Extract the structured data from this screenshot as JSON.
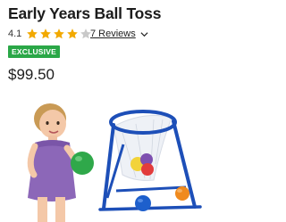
{
  "product": {
    "title": "Early Years Ball Toss",
    "rating": "4.1",
    "stars_filled": 4,
    "stars_total": 5,
    "reviews_label": "7 Reviews",
    "badge": "EXCLUSIVE",
    "price": "$99.50"
  },
  "icons": {
    "star": "star-icon",
    "chevron": "chevron-down-icon"
  },
  "colors": {
    "star": "#f2a900",
    "star_empty": "#c9c9c9",
    "badge": "#2aa747",
    "hoop_frame": "#1d4fb8"
  }
}
